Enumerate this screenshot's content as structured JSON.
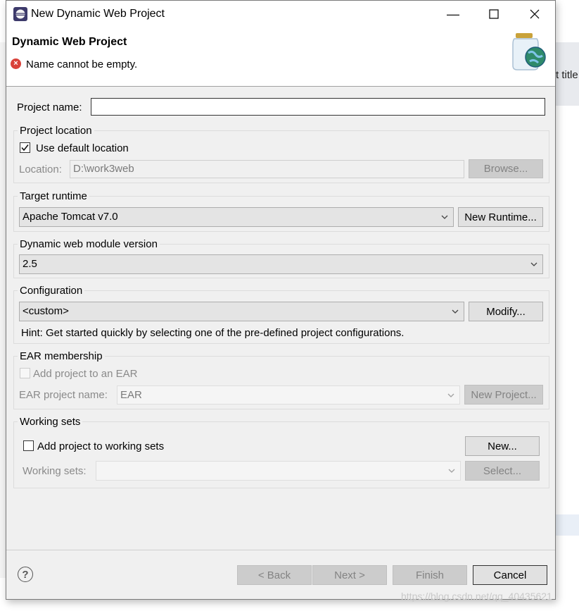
{
  "window": {
    "title": "New Dynamic Web Project",
    "minimize_glyph": "—",
    "maximize_glyph": "☐",
    "close_glyph": "✕"
  },
  "banner": {
    "title": "Dynamic Web Project",
    "message": "Name cannot be empty.",
    "error_glyph": "×"
  },
  "project_name": {
    "label": "Project name:",
    "value": ""
  },
  "location_group": {
    "title": "Project location",
    "use_default_label": "Use default location",
    "use_default_checked": true,
    "location_label": "Location:",
    "location_value": "D:\\work3web",
    "browse_label": "Browse..."
  },
  "runtime_group": {
    "title": "Target runtime",
    "selected": "Apache Tomcat v7.0",
    "new_runtime_label": "New Runtime..."
  },
  "module_group": {
    "title": "Dynamic web module version",
    "selected": "2.5"
  },
  "config_group": {
    "title": "Configuration",
    "selected": "<custom>",
    "modify_label": "Modify...",
    "hint": "Hint: Get started quickly by selecting one of the pre-defined project configurations."
  },
  "ear_group": {
    "title": "EAR membership",
    "add_label": "Add project to an EAR",
    "name_label": "EAR project name:",
    "name_value": "EAR",
    "new_project_label": "New Project..."
  },
  "working_sets_group": {
    "title": "Working sets",
    "add_label": "Add project to working sets",
    "new_label": "New...",
    "sets_label": "Working sets:",
    "select_label": "Select..."
  },
  "footer": {
    "help_glyph": "?",
    "back_label": "< Back",
    "next_label": "Next >",
    "finish_label": "Finish",
    "cancel_label": "Cancel"
  },
  "background": {
    "right_text": "t title",
    "watermark": "https://blog.csdn.net/qq_40435621"
  },
  "colors": {
    "dialog_bg": "#f0f0f0",
    "error_red": "#d9423a",
    "disabled_text": "#8a8a8a"
  }
}
